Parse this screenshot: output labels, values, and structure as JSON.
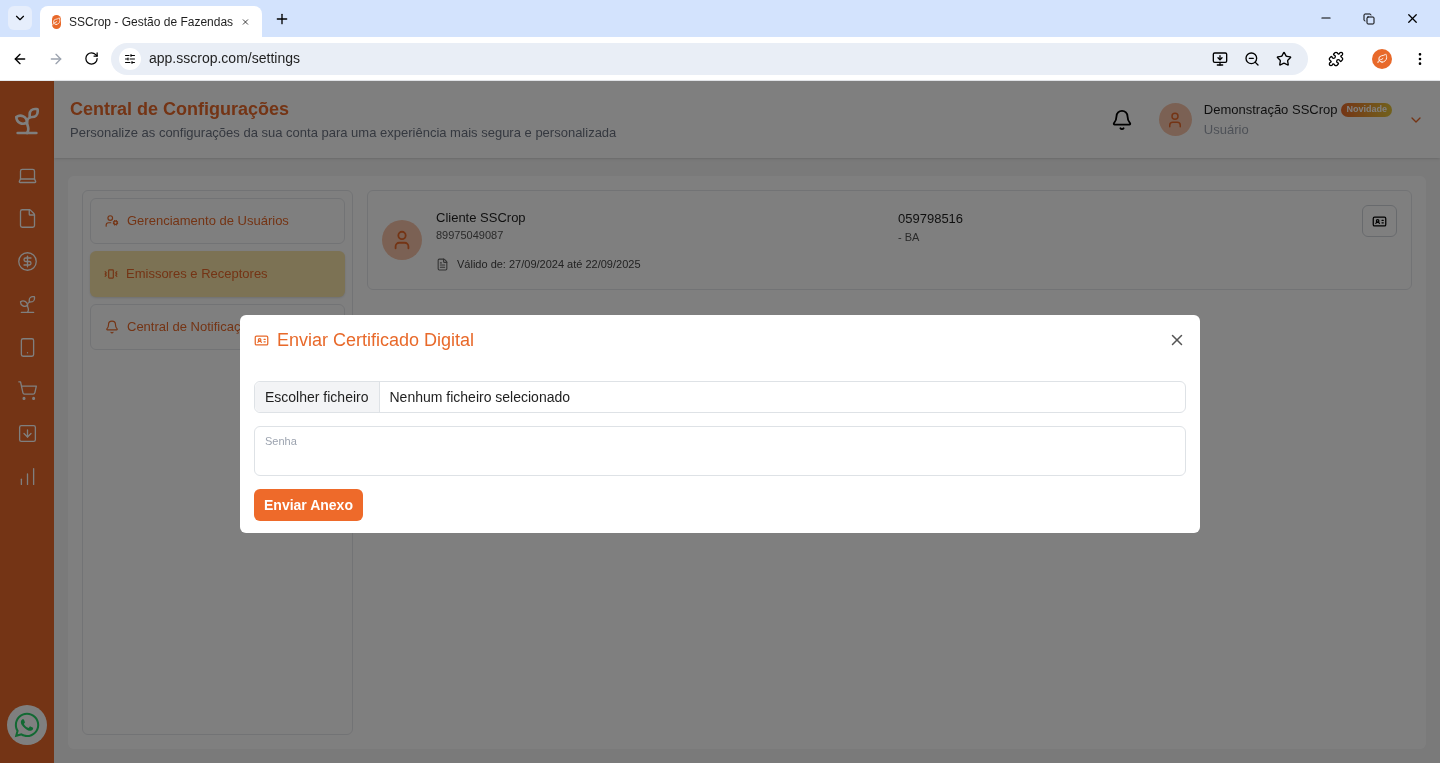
{
  "browser": {
    "tab_title": "SSCrop - Gestão de Fazendas",
    "url": "app.sscrop.com/settings"
  },
  "header": {
    "title": "Central de Configurações",
    "subtitle": "Personalize as configurações da sua conta para uma experiência mais segura e personalizada",
    "user_name": "Demonstração SSCrop",
    "badge": "Novidade",
    "role": "Usuário"
  },
  "menu": [
    {
      "label": "Gerenciamento de Usuários",
      "selected": false
    },
    {
      "label": "Emissores e Receptores",
      "selected": true
    },
    {
      "label": "Central de Notificaç",
      "selected": false
    }
  ],
  "client": {
    "name": "Cliente SSCrop",
    "document": "89975049087",
    "code": "059798516",
    "location": "- BA",
    "validity": "Válido de: 27/09/2024 até 22/09/2025"
  },
  "modal": {
    "title": "Enviar Certificado Digital",
    "file_button": "Escolher ficheiro",
    "file_status": "Nenhum ficheiro selecionado",
    "password_placeholder": "Senha",
    "submit": "Enviar Anexo"
  }
}
